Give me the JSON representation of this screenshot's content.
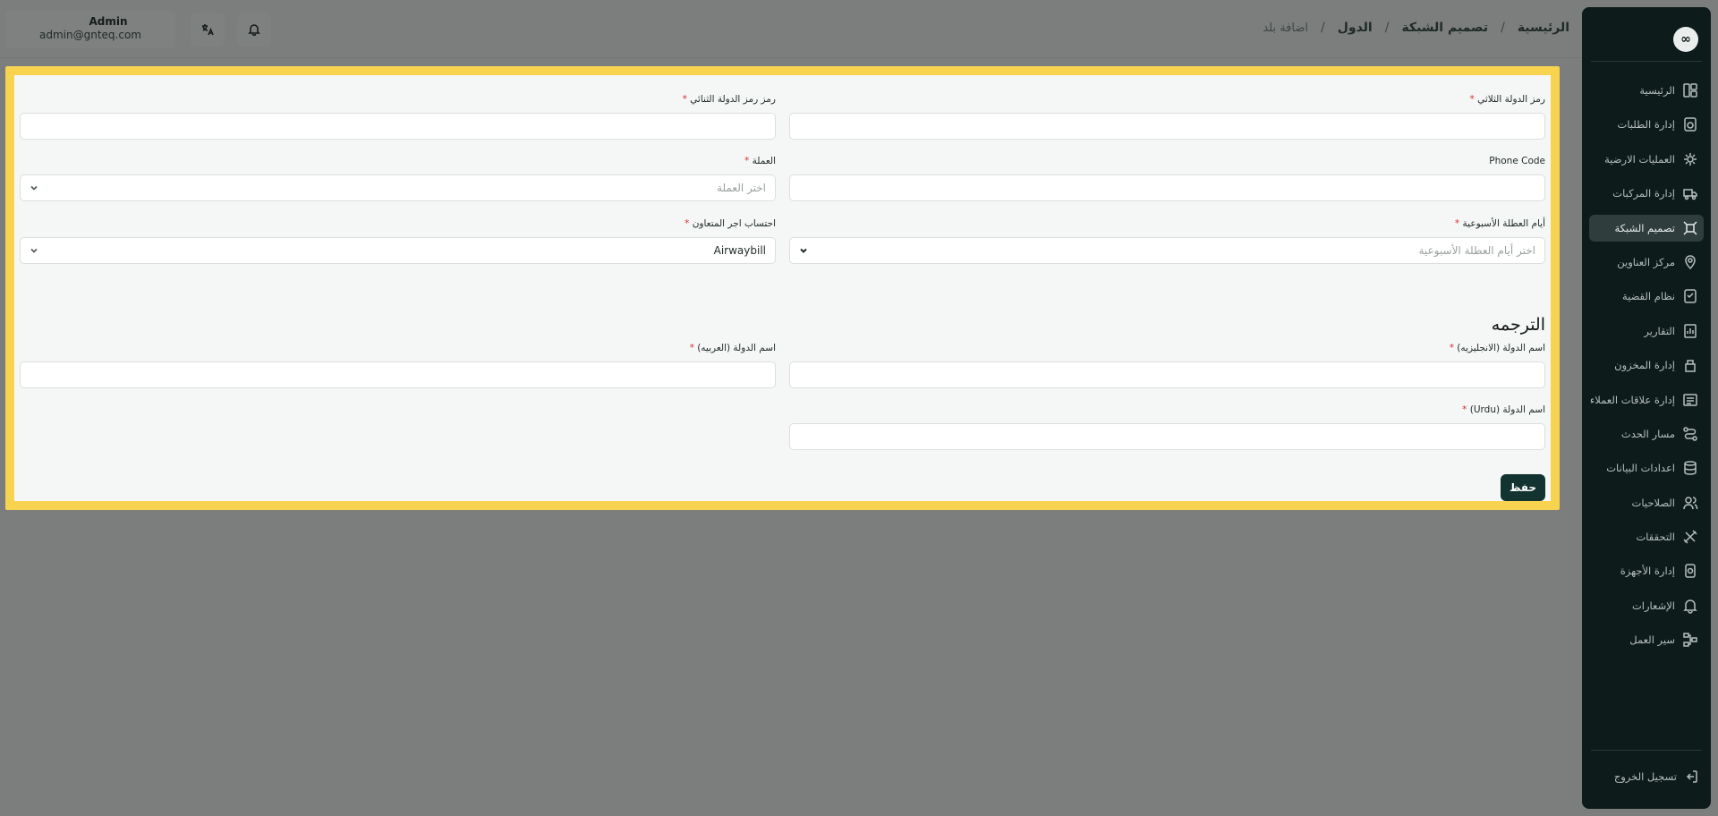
{
  "sidebar": {
    "items": [
      {
        "label": "الرئيسية",
        "icon": "home-icon"
      },
      {
        "label": "إدارة الطلبات",
        "icon": "orders-icon"
      },
      {
        "label": "العمليات الارضية",
        "icon": "ground-ops-icon"
      },
      {
        "label": "إدارة المركبات",
        "icon": "truck-icon"
      },
      {
        "label": "تصميم الشبكة",
        "icon": "network-icon",
        "active": true
      },
      {
        "label": "مركز العناوين",
        "icon": "location-icon"
      },
      {
        "label": "نظام القضية",
        "icon": "case-icon"
      },
      {
        "label": "التقارير",
        "icon": "report-icon"
      },
      {
        "label": "إدارة المخزون",
        "icon": "inventory-icon"
      },
      {
        "label": "إدارة علاقات العملاء",
        "icon": "crm-icon"
      },
      {
        "label": "مسار الحدث",
        "icon": "route-icon"
      },
      {
        "label": "اعدادات البيانات",
        "icon": "database-icon"
      },
      {
        "label": "الصلاحيات",
        "icon": "users-icon"
      },
      {
        "label": "التحققات",
        "icon": "tools-icon"
      },
      {
        "label": "إدارة الأجهزة",
        "icon": "devices-icon"
      },
      {
        "label": "الإشعارات",
        "icon": "bell-icon"
      },
      {
        "label": "سير العمل",
        "icon": "workflow-icon"
      }
    ],
    "logout": "تسجيل الخروج"
  },
  "breadcrumb": {
    "home": "الرئيسية",
    "network": "تصميم الشبكة",
    "countries": "الدول",
    "current": "اضافة بلد",
    "sep": "/"
  },
  "user": {
    "name": "Admin",
    "email": "admin@gnteq.com"
  },
  "form": {
    "iso3": {
      "label": "رمز الدولة الثلاثي",
      "req": "*"
    },
    "iso2": {
      "label": "رمز رمز الدولة الثنائي",
      "req": "*"
    },
    "phone": {
      "label": "Phone Code"
    },
    "currency": {
      "label": "العملة",
      "req": "*",
      "placeholder": "اختر العملة"
    },
    "weekend": {
      "label": "أيام العطلة الأسبوعية",
      "req": "*",
      "placeholder": "اختر أيام العطلة الأسبوعية"
    },
    "fee": {
      "label": "احتساب اجر المتعاون",
      "req": "*",
      "value": "Airwaybill"
    },
    "translation_title": "الترجمه",
    "name_en": {
      "label": "اسم الدولة  (الانجليزيه)",
      "req": "*"
    },
    "name_ar": {
      "label": "اسم الدولة  (العربيه)",
      "req": "*"
    },
    "name_ur": {
      "label": "اسم الدولة  (Urdu)",
      "req": "*"
    },
    "save": "حفظ"
  },
  "colors": {
    "highlight": "#f8d350",
    "sidebar": "#0d1c1b",
    "primary": "#12332f",
    "required": "#d32f2f"
  }
}
